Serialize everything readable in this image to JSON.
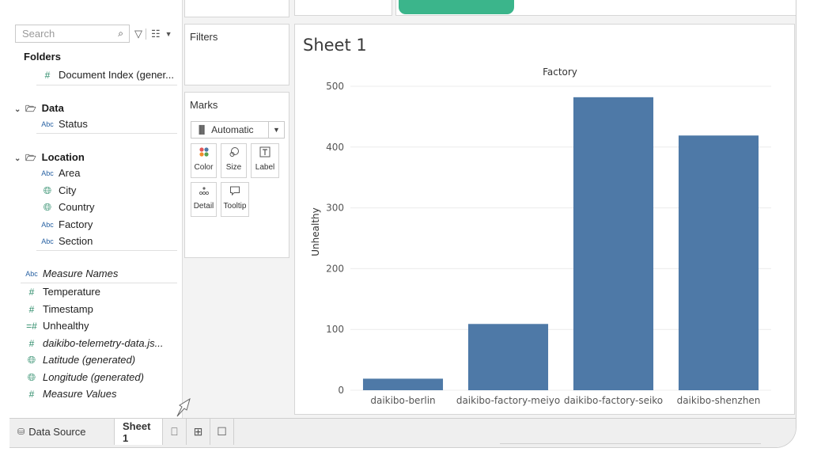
{
  "data_pane": {
    "search_placeholder": "Search",
    "folders_label": "Folders",
    "document_index": "Document Index (gener...",
    "data_folder": "Data",
    "data_fields": [
      {
        "type": "Abc",
        "name": "Status"
      }
    ],
    "location_folder": "Location",
    "location_fields": [
      {
        "type": "Abc",
        "name": "Area"
      },
      {
        "type": "globe",
        "name": "City"
      },
      {
        "type": "globe",
        "name": "Country"
      },
      {
        "type": "Abc",
        "name": "Factory"
      },
      {
        "type": "Abc",
        "name": "Section"
      }
    ],
    "measure_names": "Measure Names",
    "measures": [
      {
        "type": "#",
        "name": "Temperature",
        "italic": false
      },
      {
        "type": "#",
        "name": "Timestamp",
        "italic": false
      },
      {
        "type": "=#",
        "name": "Unhealthy",
        "italic": false
      },
      {
        "type": "#",
        "name": "daikibo-telemetry-data.js...",
        "italic": true
      },
      {
        "type": "globe",
        "name": "Latitude (generated)",
        "italic": true
      },
      {
        "type": "globe",
        "name": "Longitude (generated)",
        "italic": true
      },
      {
        "type": "#",
        "name": "Measure Values",
        "italic": true
      }
    ]
  },
  "cards": {
    "filters_label": "Filters",
    "marks_label": "Marks",
    "mark_type": "Automatic",
    "mark_buttons": [
      "Color",
      "Size",
      "Label",
      "Detail",
      "Tooltip"
    ]
  },
  "sheet": {
    "title": "Sheet 1"
  },
  "chart_data": {
    "type": "bar",
    "title": "Factory",
    "xlabel": "",
    "ylabel": "Unhealthy",
    "categories": [
      "daikibo-berlin",
      "daikibo-factory-meiyo",
      "daikibo-factory-seiko",
      "daikibo-shenzhen"
    ],
    "values": [
      19,
      109,
      482,
      419
    ],
    "ylim": [
      0,
      500
    ],
    "yticks": [
      0,
      100,
      200,
      300,
      400,
      500
    ],
    "bar_color": "#4e79a7",
    "grid": true
  },
  "tabs": {
    "data_source": "Data Source",
    "sheet1": "Sheet 1"
  }
}
